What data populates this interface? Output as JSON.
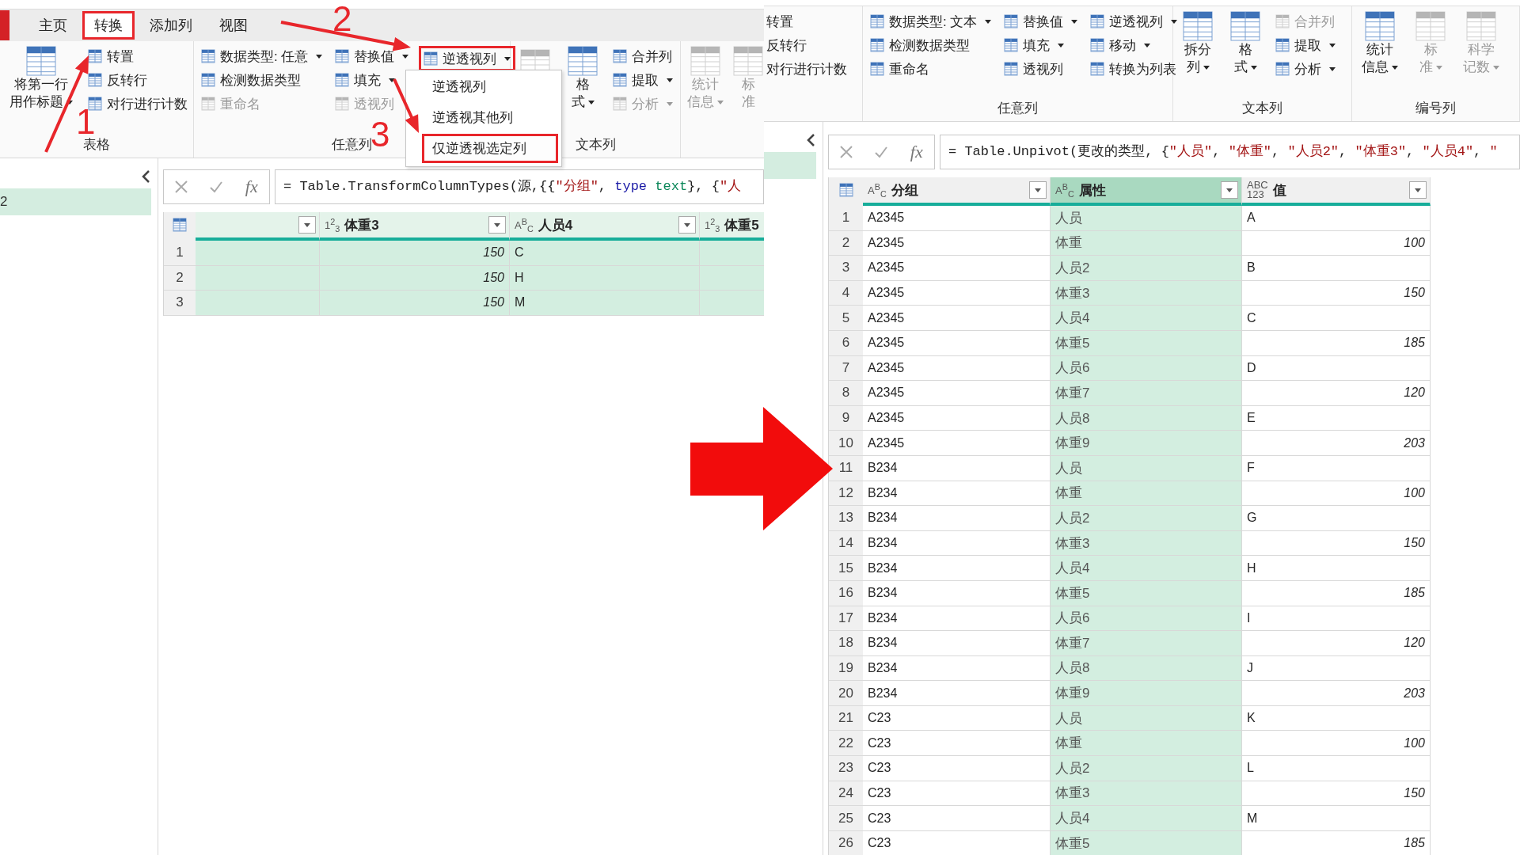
{
  "left_window": {
    "tabs": [
      {
        "label": "主页",
        "selected": false,
        "highlighted": false
      },
      {
        "label": "转换",
        "selected": true,
        "highlighted": true
      },
      {
        "label": "添加列",
        "selected": false,
        "highlighted": false
      },
      {
        "label": "视图",
        "selected": false,
        "highlighted": false
      }
    ],
    "ribbon_groups": [
      {
        "label": "表格",
        "items": [
          {
            "kind": "large",
            "lines": [
              "将第一行",
              "用作标题"
            ],
            "dropdown": true,
            "disabled": false
          },
          {
            "kind": "stack",
            "items": [
              {
                "label": "转置",
                "dropdown": false,
                "disabled": false,
                "highlighted": false
              },
              {
                "label": "反转行",
                "dropdown": false,
                "disabled": false,
                "highlighted": false
              },
              {
                "label": "对行进行计数",
                "dropdown": false,
                "disabled": false,
                "highlighted": false
              }
            ]
          }
        ]
      },
      {
        "label": "任意列",
        "items": [
          {
            "kind": "stack",
            "items": [
              {
                "label": "数据类型: 任意",
                "dropdown": true,
                "disabled": false,
                "highlighted": false
              },
              {
                "label": "检测数据类型",
                "dropdown": false,
                "disabled": false,
                "highlighted": false
              },
              {
                "label": "重命名",
                "dropdown": false,
                "disabled": true,
                "highlighted": false
              }
            ]
          },
          {
            "kind": "stack",
            "items": [
              {
                "label": "替换值",
                "dropdown": true,
                "disabled": false,
                "highlighted": false
              },
              {
                "label": "填充",
                "dropdown": true,
                "disabled": false,
                "highlighted": false
              },
              {
                "label": "透视列",
                "dropdown": false,
                "disabled": true,
                "highlighted": false
              }
            ]
          },
          {
            "kind": "stack",
            "items": [
              {
                "label": "逆透视列",
                "dropdown": true,
                "disabled": false,
                "highlighted": true
              }
            ]
          }
        ]
      },
      {
        "label": "文本列",
        "items": [
          {
            "kind": "large",
            "disabled": true
          },
          {
            "kind": "large",
            "lines": [
              "格",
              "式"
            ],
            "dropdown": true,
            "disabled": false
          },
          {
            "kind": "stack",
            "items": [
              {
                "label": "合并列",
                "dropdown": false,
                "disabled": false,
                "highlighted": false
              },
              {
                "label": "提取",
                "dropdown": true,
                "disabled": false,
                "highlighted": false
              },
              {
                "label": "分析",
                "dropdown": true,
                "disabled": true,
                "highlighted": false
              }
            ]
          }
        ]
      },
      {
        "items": [
          {
            "kind": "large",
            "lines": [
              "统计",
              "信息"
            ],
            "dropdown": true,
            "disabled": true
          },
          {
            "kind": "large",
            "lines": [
              "标",
              "准"
            ],
            "dropdown": false,
            "disabled": true
          }
        ]
      }
    ],
    "menu": [
      {
        "label": "逆透视列",
        "highlighted": false
      },
      {
        "label": "逆透视其他列",
        "highlighted": false
      },
      {
        "label": "仅逆透视选定列",
        "highlighted": true
      }
    ],
    "annotations": [
      {
        "label": "1"
      },
      {
        "label": "2"
      },
      {
        "label": "3"
      }
    ],
    "sidebar": {
      "items": [
        {
          "label": "2",
          "selected": true
        }
      ]
    },
    "formula": {
      "fx": "fx",
      "tokens": [
        {
          "kind": "plain",
          "text": "= Table.TransformColumnTypes(源,{{"
        },
        {
          "kind": "string",
          "text": "\"分组\""
        },
        {
          "kind": "plain",
          "text": ", "
        },
        {
          "kind": "keyword",
          "text": "type"
        },
        {
          "kind": "type",
          "text": " text"
        },
        {
          "kind": "plain",
          "text": "}, {"
        },
        {
          "kind": "string",
          "text": "\"人"
        }
      ]
    },
    "table": {
      "columns": [
        {
          "selected": true
        },
        {
          "type_mark": [
            "1$^{2}$$_{3}$"
          ],
          "name": "体重3",
          "selected": true
        },
        {
          "type_mark": [
            "A$^{B}$$_{C}$"
          ],
          "name": "人员4",
          "selected": true
        },
        {
          "type_mark": [
            "1$^{2}$$_{3}$"
          ],
          "name": "体重5",
          "selected": true
        }
      ],
      "rows": [
        {
          "n": "1",
          "cells": [
            {
              "kind": "blank"
            },
            {
              "kind": "number",
              "text": "150"
            },
            {
              "kind": "text",
              "text": "C"
            },
            {
              "kind": "blank"
            }
          ]
        },
        {
          "n": "2",
          "cells": [
            {
              "kind": "blank"
            },
            {
              "kind": "number",
              "text": "150"
            },
            {
              "kind": "text",
              "text": "H"
            },
            {
              "kind": "blank"
            }
          ]
        },
        {
          "n": "3",
          "cells": [
            {
              "kind": "blank"
            },
            {
              "kind": "number",
              "text": "150"
            },
            {
              "kind": "text",
              "text": "M"
            },
            {
              "kind": "blank"
            }
          ]
        }
      ]
    }
  },
  "right_window": {
    "ribbon_groups": [
      {
        "items": [
          {
            "kind": "stack",
            "items": [
              {
                "label": "转置",
                "dropdown": false,
                "disabled": false,
                "highlighted": false
              },
              {
                "label": "反转行",
                "dropdown": false,
                "disabled": false,
                "highlighted": false
              },
              {
                "label": "对行进行计数",
                "dropdown": false,
                "disabled": false,
                "highlighted": false
              }
            ]
          }
        ]
      },
      {
        "label": "任意列",
        "items": [
          {
            "kind": "stack",
            "items": [
              {
                "label": "数据类型: 文本",
                "dropdown": true,
                "disabled": false,
                "highlighted": false
              },
              {
                "label": "检测数据类型",
                "dropdown": false,
                "disabled": false,
                "highlighted": false
              },
              {
                "label": "重命名",
                "dropdown": false,
                "disabled": false,
                "highlighted": false
              }
            ]
          },
          {
            "kind": "stack",
            "items": [
              {
                "label": "替换值",
                "dropdown": true,
                "disabled": false,
                "highlighted": false
              },
              {
                "label": "填充",
                "dropdown": true,
                "disabled": false,
                "highlighted": false
              },
              {
                "label": "透视列",
                "dropdown": false,
                "disabled": false,
                "highlighted": false
              }
            ]
          },
          {
            "kind": "stack",
            "items": [
              {
                "label": "逆透视列",
                "dropdown": true,
                "disabled": false,
                "highlighted": false
              },
              {
                "label": "移动",
                "dropdown": true,
                "disabled": false,
                "highlighted": false
              },
              {
                "label": "转换为列表",
                "dropdown": false,
                "disabled": false,
                "highlighted": false
              }
            ]
          }
        ]
      },
      {
        "label": "文本列",
        "items": [
          {
            "kind": "large",
            "lines": [
              "拆分",
              "列"
            ],
            "dropdown": true,
            "disabled": false
          },
          {
            "kind": "large",
            "lines": [
              "格",
              "式"
            ],
            "dropdown": true,
            "disabled": false
          },
          {
            "kind": "stack",
            "items": [
              {
                "label": "合并列",
                "dropdown": false,
                "disabled": true,
                "highlighted": false
              },
              {
                "label": "提取",
                "dropdown": true,
                "disabled": false,
                "highlighted": false
              },
              {
                "label": "分析",
                "dropdown": true,
                "disabled": false,
                "highlighted": false
              }
            ]
          }
        ]
      },
      {
        "label": "编号列",
        "items": [
          {
            "kind": "large",
            "lines": [
              "统计",
              "信息"
            ],
            "dropdown": true,
            "disabled": false
          },
          {
            "kind": "large",
            "lines": [
              "标",
              "准"
            ],
            "dropdown": true,
            "disabled": true
          },
          {
            "kind": "large",
            "lines": [
              "科学",
              "记数"
            ],
            "dropdown": true,
            "disabled": true
          }
        ]
      }
    ],
    "sidebar": {
      "items": [
        {
          "selected": true
        }
      ]
    },
    "formula": {
      "fx": "fx",
      "tokens": [
        {
          "kind": "plain",
          "text": "= Table.Unpivot(更改的类型, {"
        },
        {
          "kind": "string",
          "text": "\"人员\""
        },
        {
          "kind": "plain",
          "text": ", "
        },
        {
          "kind": "string",
          "text": "\"体重\""
        },
        {
          "kind": "plain",
          "text": ", "
        },
        {
          "kind": "string",
          "text": "\"人员2\""
        },
        {
          "kind": "plain",
          "text": ", "
        },
        {
          "kind": "string",
          "text": "\"体重3\""
        },
        {
          "kind": "plain",
          "text": ", "
        },
        {
          "kind": "string",
          "text": "\"人员4\""
        },
        {
          "kind": "plain",
          "text": ", "
        },
        {
          "kind": "string",
          "text": "\""
        }
      ]
    },
    "table": {
      "columns": [
        {
          "type_mark": [
            "A$^{B}$$_{C}$"
          ],
          "name": "分组",
          "selected": false
        },
        {
          "type_mark": [
            "A$^{B}$$_{C}$"
          ],
          "name": "属性",
          "selected": true
        },
        {
          "type_mark": [
            "ABC",
            "123"
          ],
          "name": "值",
          "selected": false
        }
      ],
      "rows": [
        {
          "n": "1",
          "cells": [
            {
              "kind": "text",
              "text": "A2345"
            },
            {
              "kind": "text",
              "text": "人员"
            },
            {
              "kind": "text",
              "text": "A"
            }
          ]
        },
        {
          "n": "2",
          "cells": [
            {
              "kind": "text",
              "text": "A2345"
            },
            {
              "kind": "text",
              "text": "体重"
            },
            {
              "kind": "number",
              "text": "100"
            }
          ]
        },
        {
          "n": "3",
          "cells": [
            {
              "kind": "text",
              "text": "A2345"
            },
            {
              "kind": "text",
              "text": "人员2"
            },
            {
              "kind": "text",
              "text": "B"
            }
          ]
        },
        {
          "n": "4",
          "cells": [
            {
              "kind": "text",
              "text": "A2345"
            },
            {
              "kind": "text",
              "text": "体重3"
            },
            {
              "kind": "number",
              "text": "150"
            }
          ]
        },
        {
          "n": "5",
          "cells": [
            {
              "kind": "text",
              "text": "A2345"
            },
            {
              "kind": "text",
              "text": "人员4"
            },
            {
              "kind": "text",
              "text": "C"
            }
          ]
        },
        {
          "n": "6",
          "cells": [
            {
              "kind": "text",
              "text": "A2345"
            },
            {
              "kind": "text",
              "text": "体重5"
            },
            {
              "kind": "number",
              "text": "185"
            }
          ]
        },
        {
          "n": "7",
          "cells": [
            {
              "kind": "text",
              "text": "A2345"
            },
            {
              "kind": "text",
              "text": "人员6"
            },
            {
              "kind": "text",
              "text": "D"
            }
          ]
        },
        {
          "n": "8",
          "cells": [
            {
              "kind": "text",
              "text": "A2345"
            },
            {
              "kind": "text",
              "text": "体重7"
            },
            {
              "kind": "number",
              "text": "120"
            }
          ]
        },
        {
          "n": "9",
          "cells": [
            {
              "kind": "text",
              "text": "A2345"
            },
            {
              "kind": "text",
              "text": "人员8"
            },
            {
              "kind": "text",
              "text": "E"
            }
          ]
        },
        {
          "n": "10",
          "cells": [
            {
              "kind": "text",
              "text": "A2345"
            },
            {
              "kind": "text",
              "text": "体重9"
            },
            {
              "kind": "number",
              "text": "203"
            }
          ]
        },
        {
          "n": "11",
          "cells": [
            {
              "kind": "text",
              "text": "B234"
            },
            {
              "kind": "text",
              "text": "人员"
            },
            {
              "kind": "text",
              "text": "F"
            }
          ]
        },
        {
          "n": "12",
          "cells": [
            {
              "kind": "text",
              "text": "B234"
            },
            {
              "kind": "text",
              "text": "体重"
            },
            {
              "kind": "number",
              "text": "100"
            }
          ]
        },
        {
          "n": "13",
          "cells": [
            {
              "kind": "text",
              "text": "B234"
            },
            {
              "kind": "text",
              "text": "人员2"
            },
            {
              "kind": "text",
              "text": "G"
            }
          ]
        },
        {
          "n": "14",
          "cells": [
            {
              "kind": "text",
              "text": "B234"
            },
            {
              "kind": "text",
              "text": "体重3"
            },
            {
              "kind": "number",
              "text": "150"
            }
          ]
        },
        {
          "n": "15",
          "cells": [
            {
              "kind": "text",
              "text": "B234"
            },
            {
              "kind": "text",
              "text": "人员4"
            },
            {
              "kind": "text",
              "text": "H"
            }
          ]
        },
        {
          "n": "16",
          "cells": [
            {
              "kind": "text",
              "text": "B234"
            },
            {
              "kind": "text",
              "text": "体重5"
            },
            {
              "kind": "number",
              "text": "185"
            }
          ]
        },
        {
          "n": "17",
          "cells": [
            {
              "kind": "text",
              "text": "B234"
            },
            {
              "kind": "text",
              "text": "人员6"
            },
            {
              "kind": "text",
              "text": "I"
            }
          ]
        },
        {
          "n": "18",
          "cells": [
            {
              "kind": "text",
              "text": "B234"
            },
            {
              "kind": "text",
              "text": "体重7"
            },
            {
              "kind": "number",
              "text": "120"
            }
          ]
        },
        {
          "n": "19",
          "cells": [
            {
              "kind": "text",
              "text": "B234"
            },
            {
              "kind": "text",
              "text": "人员8"
            },
            {
              "kind": "text",
              "text": "J"
            }
          ]
        },
        {
          "n": "20",
          "cells": [
            {
              "kind": "text",
              "text": "B234"
            },
            {
              "kind": "text",
              "text": "体重9"
            },
            {
              "kind": "number",
              "text": "203"
            }
          ]
        },
        {
          "n": "21",
          "cells": [
            {
              "kind": "text",
              "text": "C23"
            },
            {
              "kind": "text",
              "text": "人员"
            },
            {
              "kind": "text",
              "text": "K"
            }
          ]
        },
        {
          "n": "22",
          "cells": [
            {
              "kind": "text",
              "text": "C23"
            },
            {
              "kind": "text",
              "text": "体重"
            },
            {
              "kind": "number",
              "text": "100"
            }
          ]
        },
        {
          "n": "23",
          "cells": [
            {
              "kind": "text",
              "text": "C23"
            },
            {
              "kind": "text",
              "text": "人员2"
            },
            {
              "kind": "text",
              "text": "L"
            }
          ]
        },
        {
          "n": "24",
          "cells": [
            {
              "kind": "text",
              "text": "C23"
            },
            {
              "kind": "text",
              "text": "体重3"
            },
            {
              "kind": "number",
              "text": "150"
            }
          ]
        },
        {
          "n": "25",
          "cells": [
            {
              "kind": "text",
              "text": "C23"
            },
            {
              "kind": "text",
              "text": "人员4"
            },
            {
              "kind": "text",
              "text": "M"
            }
          ]
        },
        {
          "n": "26",
          "cells": [
            {
              "kind": "text",
              "text": "C23"
            },
            {
              "kind": "text",
              "text": "体重5"
            },
            {
              "kind": "number",
              "text": "185"
            }
          ]
        }
      ]
    }
  }
}
